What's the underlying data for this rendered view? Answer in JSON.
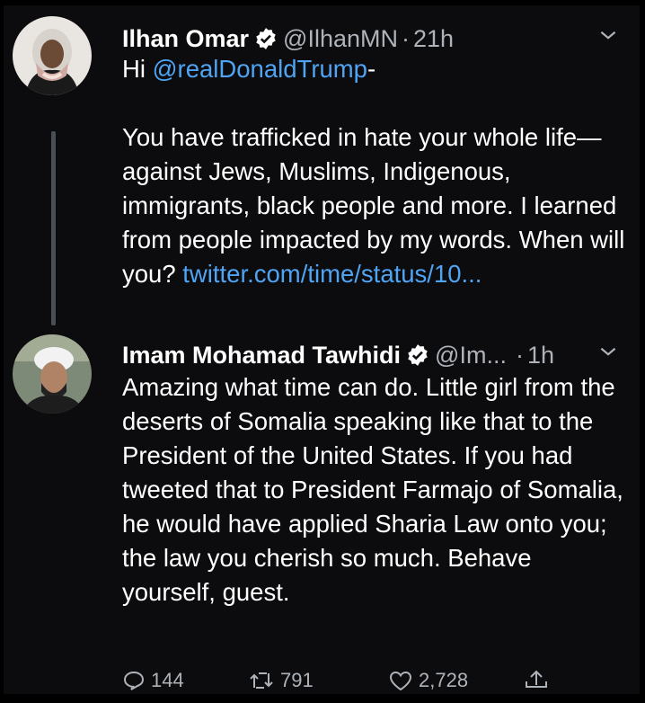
{
  "tweets": [
    {
      "author": "Ilhan Omar",
      "handle": "@IlhanMN",
      "separator": "·",
      "time": "21h",
      "greeting": "Hi ",
      "mention": "@realDonaldTrump",
      "after_mention": "-",
      "text": "You have trafficked in hate your whole life—against Jews, Muslims, Indigenous, immigrants, black people and more. I learned from people impacted by my words. When will you? ",
      "link": "twitter.com/time/status/10..."
    },
    {
      "author": "Imam Mohamad Tawhidi",
      "handle": "@Im...",
      "separator": "·",
      "time": "1h",
      "text": "Amazing what time can do. Little girl from the deserts of Somalia speaking like that to the President of the United States. If you had tweeted that to President Farmajo of Somalia, he would have applied Sharia Law onto you; the law you cherish so much. Behave yourself, guest.",
      "replies": "144",
      "retweets": "791",
      "likes": "2,728"
    }
  ],
  "colors": {
    "background": "#0c0c0e",
    "secondary_text": "#aeb3ba",
    "link": "#4fa4f3",
    "verified": "#ffffff"
  },
  "icons": [
    "verified-icon",
    "chevron-down-icon",
    "reply-icon",
    "retweet-icon",
    "like-icon",
    "share-icon"
  ]
}
